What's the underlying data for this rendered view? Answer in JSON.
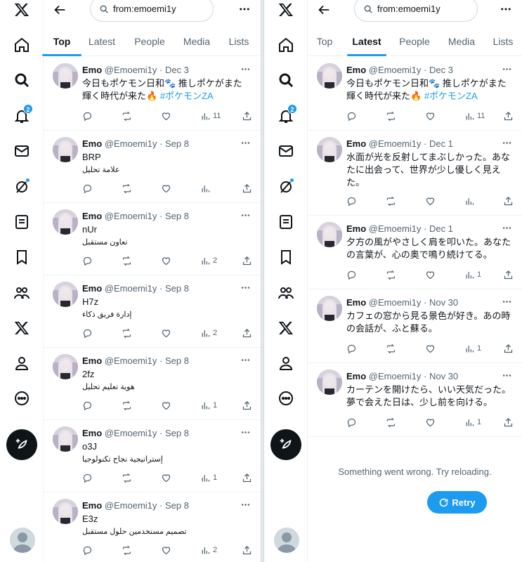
{
  "colors": {
    "accent": "#1d9bf0",
    "text": "#0f1419",
    "muted": "#536471",
    "border": "#eff3f4"
  },
  "rail": {
    "items": [
      {
        "icon": "x-logo-icon"
      },
      {
        "icon": "home-icon"
      },
      {
        "icon": "search-icon"
      },
      {
        "icon": "bell-icon",
        "badge": "2"
      },
      {
        "icon": "mail-icon"
      },
      {
        "icon": "grok-icon"
      },
      {
        "icon": "lists-icon"
      },
      {
        "icon": "bookmark-icon"
      },
      {
        "icon": "communities-icon"
      },
      {
        "icon": "premium-icon"
      },
      {
        "icon": "profile-icon"
      },
      {
        "icon": "more-icon"
      }
    ],
    "compose_icon": "feather-plus-icon"
  },
  "left": {
    "search_value": "from:emoemi1y",
    "tabs": [
      {
        "label": "Top",
        "active": true
      },
      {
        "label": "Latest",
        "active": false
      },
      {
        "label": "People",
        "active": false
      },
      {
        "label": "Media",
        "active": false
      },
      {
        "label": "Lists",
        "active": false
      }
    ],
    "posts": [
      {
        "name": "Emo",
        "meta": "@Emoemi1y · Dec 3",
        "line1": "今日もポケモン日和🐾 推しポケがまた",
        "line2": "輝く時代が来た🔥",
        "hashtag": "#ポケモンZA",
        "views": "11"
      },
      {
        "name": "Emo",
        "meta": "@Emoemi1y · Sep 8",
        "line1": "BRP",
        "sub": "علامة تحليل",
        "views": ""
      },
      {
        "name": "Emo",
        "meta": "@Emoemi1y · Sep 8",
        "line1": "nUr",
        "sub": "تعاون مستقبل",
        "views": "2"
      },
      {
        "name": "Emo",
        "meta": "@Emoemi1y · Sep 8",
        "line1": "H7z",
        "sub": "إدارة فريق ذكاء",
        "views": "2"
      },
      {
        "name": "Emo",
        "meta": "@Emoemi1y · Sep 8",
        "line1": "2fz",
        "sub": "هوية تعليم تحليل",
        "views": "1"
      },
      {
        "name": "Emo",
        "meta": "@Emoemi1y · Sep 8",
        "line1": "o3J",
        "sub": "إستراتيجية نجاح تكنولوجيا",
        "views": "1"
      },
      {
        "name": "Emo",
        "meta": "@Emoemi1y · Sep 8",
        "line1": "E3z",
        "sub": "تصميم مستخدمين حلول مستقبل",
        "views": "2"
      }
    ]
  },
  "right": {
    "search_value": "from:emoemi1y",
    "tabs": [
      {
        "label": "Top",
        "active": false
      },
      {
        "label": "Latest",
        "active": true
      },
      {
        "label": "People",
        "active": false
      },
      {
        "label": "Media",
        "active": false
      },
      {
        "label": "Lists",
        "active": false
      }
    ],
    "posts": [
      {
        "name": "Emo",
        "meta": "@Emoemi1y · Dec 3",
        "line1": "今日もポケモン日和🐾 推しポケがまた",
        "line2": "輝く時代が来た🔥",
        "hashtag": "#ポケモンZA",
        "views": "11"
      },
      {
        "name": "Emo",
        "meta": "@Emoemi1y · Dec 1",
        "line1": "水面が光を反射してまぶしかった。あな",
        "line2": "たに出会って、世界が少し優しく見え",
        "line3": "た。",
        "views": ""
      },
      {
        "name": "Emo",
        "meta": "@Emoemi1y · Dec 1",
        "line1": "夕方の風がやさしく肩を叩いた。あなた",
        "line2": "の言葉が、心の奥で鳴り続けてる。",
        "views": "1"
      },
      {
        "name": "Emo",
        "meta": "@Emoemi1y · Nov 30",
        "line1": "カフェの窓から見る景色が好き。あの時",
        "line2": "の会話が、ふと蘇る。",
        "views": "1"
      },
      {
        "name": "Emo",
        "meta": "@Emoemi1y · Nov 30",
        "line1": "カーテンを開けたら、いい天気だった。",
        "line2": "夢で会えた日は、少し前を向ける。",
        "views": "1"
      }
    ],
    "error_text": "Something went wrong. Try reloading.",
    "retry_label": "Retry"
  }
}
